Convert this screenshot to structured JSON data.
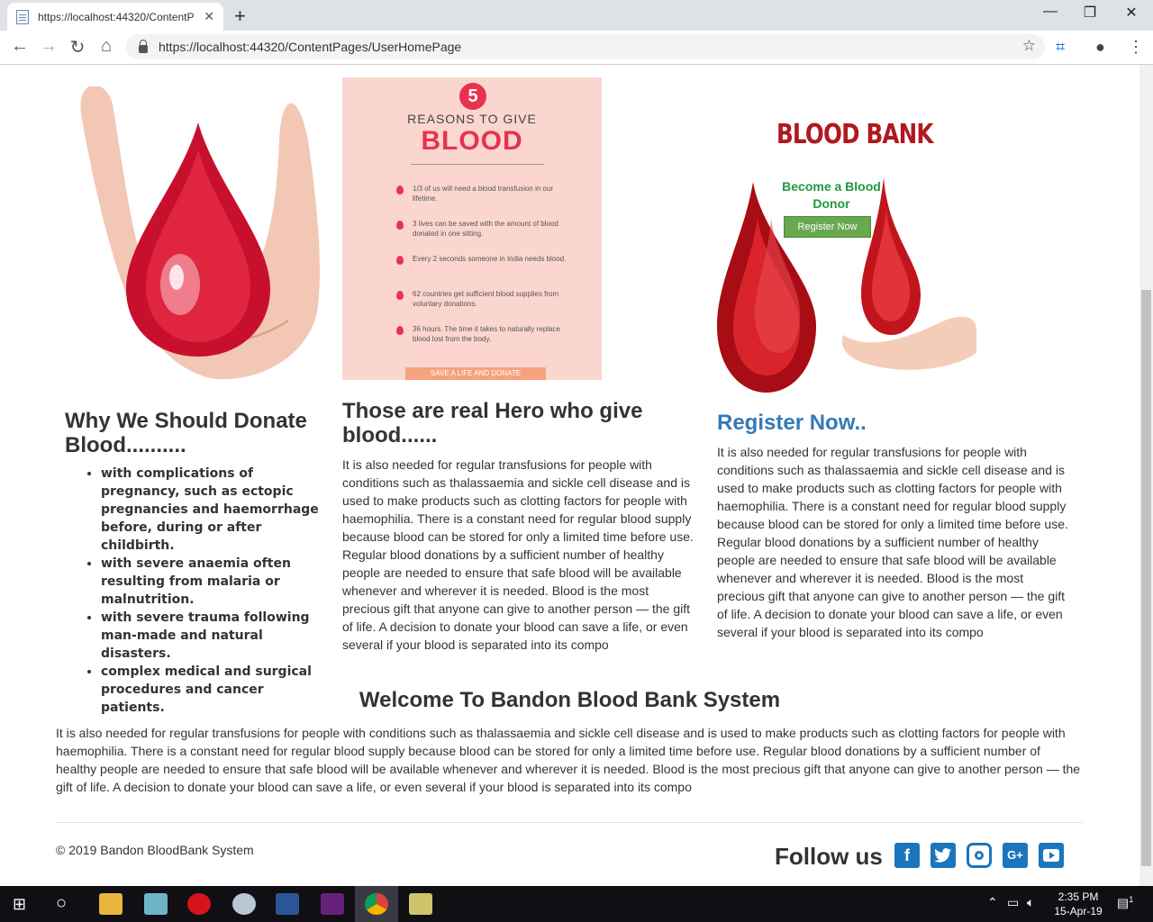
{
  "browser": {
    "tab_title": "https://localhost:44320/ContentP",
    "url": "https://localhost:44320/ContentPages/UserHomePage"
  },
  "images": {
    "reasons": {
      "number": "5",
      "subtitle": "REASONS TO GIVE",
      "title": "BLOOD",
      "items": [
        "1/3 of us will need a blood transfusion in our lifetime.",
        "3 lives can be saved with the amount of blood donated in one sitting.",
        "Every 2 seconds someone in India needs blood.",
        "62 countries get sufficient blood supplies from voluntary donations.",
        "36 hours. The time it takes to naturally replace blood lost from the body."
      ],
      "button": "SAVE A LIFE AND DONATE"
    },
    "bank": {
      "title": "BLOOD BANK",
      "become": "Become a Blood Donor",
      "button": "Register Now"
    }
  },
  "col1": {
    "title": "Why We Should Donate Blood..........",
    "bullets": [
      "with complications of pregnancy, such as ectopic pregnancies and haemorrhage before, during or after childbirth.",
      "with severe anaemia often resulting from malaria or malnutrition.",
      "with severe trauma following man-made and natural disasters.",
      "complex medical and surgical procedures and cancer patients."
    ]
  },
  "col2": {
    "title": "Those are real Hero who give blood......",
    "text": "It is also needed for regular transfusions for people with conditions such as thalassaemia and sickle cell disease and is used to make products such as clotting factors for people with haemophilia. There is a constant need for regular blood supply because blood can be stored for only a limited time before use. Regular blood donations by a sufficient number of healthy people are needed to ensure that safe blood will be available whenever and wherever it is needed. Blood is the most precious gift that anyone can give to another person — the gift of life. A decision to donate your blood can save a life, or even several if your blood is separated into its compo"
  },
  "col3": {
    "title": "Register Now..",
    "text": "It is also needed for regular transfusions for people with conditions such as thalassaemia and sickle cell disease and is used to make products such as clotting factors for people with haemophilia. There is a constant need for regular blood supply because blood can be stored for only a limited time before use. Regular blood donations by a sufficient number of healthy people are needed to ensure that safe blood will be available whenever and wherever it is needed. Blood is the most precious gift that anyone can give to another person — the gift of life. A decision to donate your blood can save a life, or even several if your blood is separated into its compo"
  },
  "welcome": {
    "title": "Welcome To Bandon Blood Bank System",
    "text": "It is also needed for regular transfusions for people with conditions such as thalassaemia and sickle cell disease and is used to make products such as clotting factors for people with haemophilia. There is a constant need for regular blood supply because blood can be stored for only a limited time before use. Regular blood donations by a sufficient number of healthy people are needed to ensure that safe blood will be available whenever and wherever it is needed. Blood is the most precious gift that anyone can give to another person — the gift of life. A decision to donate your blood can save a life, or even several if your blood is separated into its compo"
  },
  "footer": {
    "copyright": "© 2019 Bandon BloodBank System",
    "follow": "Follow us",
    "social_icons": [
      "facebook-icon",
      "twitter-icon",
      "instagram-icon",
      "google-plus-icon",
      "youtube-icon"
    ]
  },
  "taskbar": {
    "time": "2:35 PM",
    "date": "15-Apr-19",
    "notification_count": "1"
  }
}
